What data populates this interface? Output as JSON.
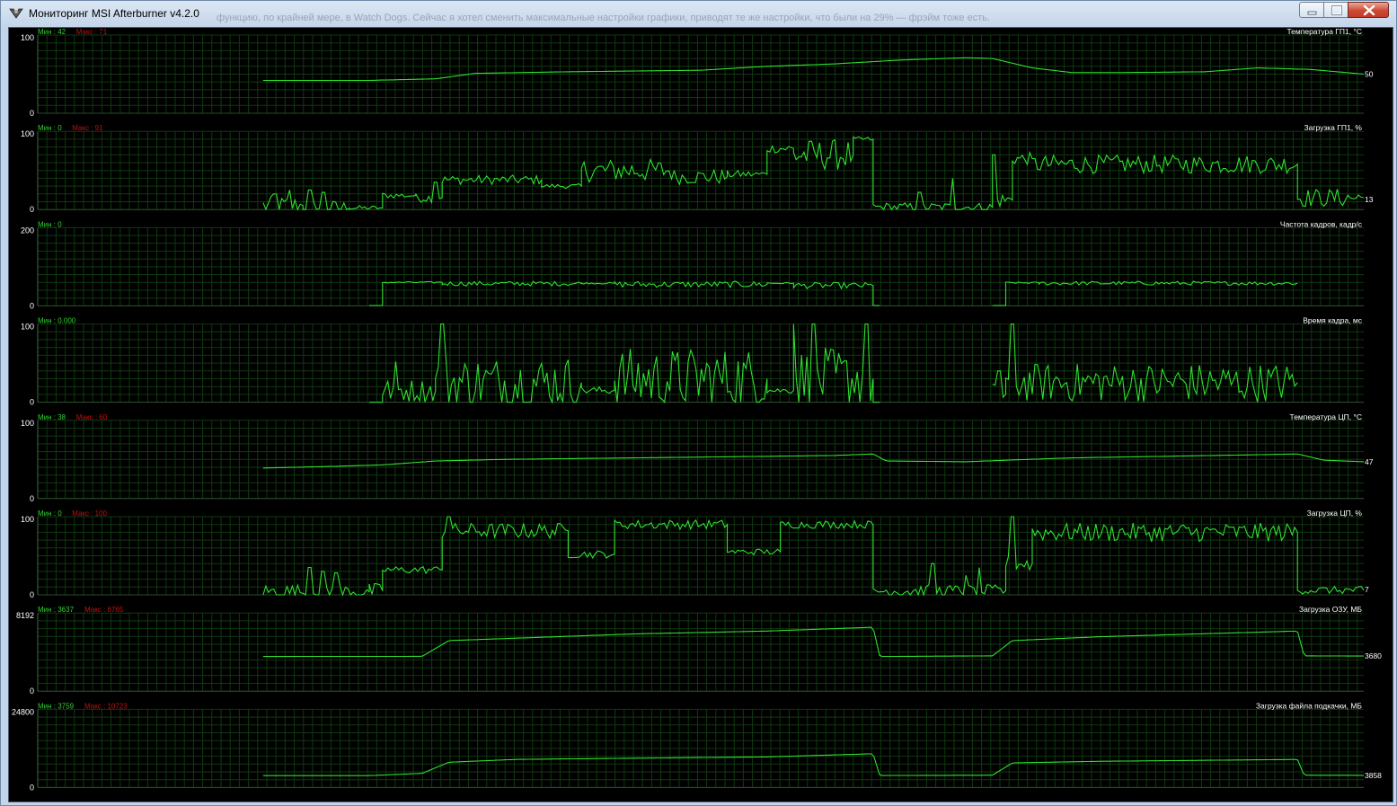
{
  "window": {
    "title": "Мониторинг MSI Afterburner v4.2.0",
    "background_text": "функцию, по крайней мере, в Watch Dogs. Сейчас я хотел сменить максимальные настройки графики, приводят те же настройки, что были на 29% — фрэйм тоже есть.",
    "controls": [
      "minimize-icon",
      "maximize-icon",
      "close-icon"
    ]
  },
  "colors": {
    "background": "#000000",
    "grid": "#0f3a0f",
    "line": "#2fe02f",
    "label": "#ffffff",
    "min_text": "#2fd12f",
    "max_text": "#c01010"
  },
  "chart_data": [
    {
      "type": "line",
      "title": "Температура ГП1, °C",
      "ylim": [
        0,
        100
      ],
      "ytick_top": "100",
      "ytick_bottom": "0",
      "min_label": "Мин : 42",
      "max_label": "Макс : 71",
      "current": "50",
      "x_start": 0.17,
      "anchors": [
        [
          0.17,
          42
        ],
        [
          0.25,
          42
        ],
        [
          0.3,
          44
        ],
        [
          0.33,
          51
        ],
        [
          0.4,
          53
        ],
        [
          0.5,
          55
        ],
        [
          0.55,
          60
        ],
        [
          0.6,
          63
        ],
        [
          0.65,
          68
        ],
        [
          0.7,
          71
        ],
        [
          0.72,
          70
        ],
        [
          0.75,
          58
        ],
        [
          0.78,
          52
        ],
        [
          0.82,
          52
        ],
        [
          0.88,
          53
        ],
        [
          0.92,
          58
        ],
        [
          0.96,
          56
        ],
        [
          1.0,
          50
        ]
      ]
    },
    {
      "type": "line",
      "title": "Загрузка ГП1, %",
      "ylim": [
        0,
        100
      ],
      "ytick_top": "100",
      "ytick_bottom": "0",
      "min_label": "Мин : 0",
      "max_label": "Макс : 91",
      "current": "13",
      "x_start": 0.17,
      "segments": [
        {
          "x": [
            0.17,
            0.2
          ],
          "level": 5,
          "noise": 12,
          "spikes": [
            [
              0.18,
              20
            ],
            [
              0.19,
              25
            ]
          ]
        },
        {
          "x": [
            0.2,
            0.235
          ],
          "level": 2,
          "noise": 10,
          "spikes": [
            [
              0.205,
              25
            ],
            [
              0.215,
              22
            ]
          ]
        },
        {
          "x": [
            0.235,
            0.26
          ],
          "level": 2,
          "noise": 3
        },
        {
          "x": [
            0.26,
            0.285
          ],
          "level": 18,
          "noise": 4
        },
        {
          "x": [
            0.285,
            0.305
          ],
          "level": 15,
          "noise": 6,
          "spikes": [
            [
              0.3,
              35
            ]
          ]
        },
        {
          "x": [
            0.305,
            0.38
          ],
          "level": 38,
          "noise": 6
        },
        {
          "x": [
            0.38,
            0.41
          ],
          "level": 30,
          "noise": 3
        },
        {
          "x": [
            0.41,
            0.48
          ],
          "level": 50,
          "noise": 15
        },
        {
          "x": [
            0.48,
            0.52
          ],
          "level": 42,
          "noise": 10
        },
        {
          "x": [
            0.52,
            0.55
          ],
          "level": 45,
          "noise": 5
        },
        {
          "x": [
            0.55,
            0.57
          ],
          "level": 78,
          "noise": 6
        },
        {
          "x": [
            0.57,
            0.615
          ],
          "level": 70,
          "noise": 20
        },
        {
          "x": [
            0.615,
            0.63
          ],
          "level": 90,
          "noise": 3
        },
        {
          "x": [
            0.63,
            0.72
          ],
          "level": 3,
          "noise": 6,
          "spikes": [
            [
              0.665,
              22
            ],
            [
              0.69,
              40
            ]
          ]
        },
        {
          "x": [
            0.72,
            0.735
          ],
          "level": 12,
          "noise": 10,
          "spikes": [
            [
              0.72,
              70
            ]
          ]
        },
        {
          "x": [
            0.735,
            0.75
          ],
          "level": 65,
          "noise": 8
        },
        {
          "x": [
            0.75,
            0.95
          ],
          "level": 58,
          "noise": 12
        },
        {
          "x": [
            0.95,
            1.0
          ],
          "level": 15,
          "noise": 12
        }
      ]
    },
    {
      "type": "line",
      "title": "Частота кадров, кадр/с",
      "ylim": [
        0,
        200
      ],
      "ytick_top": "200",
      "ytick_bottom": "0",
      "min_label": "Мин : 0",
      "max_label": "",
      "current": "",
      "x_start": 0.25,
      "segments": [
        {
          "x": [
            0.25,
            0.26
          ],
          "level": 1,
          "noise": 0
        },
        {
          "x": [
            0.26,
            0.305
          ],
          "level": 60,
          "noise": 2
        },
        {
          "x": [
            0.305,
            0.41
          ],
          "level": 57,
          "noise": 6
        },
        {
          "x": [
            0.41,
            0.435
          ],
          "level": 58,
          "noise": 2
        },
        {
          "x": [
            0.435,
            0.55
          ],
          "level": 55,
          "noise": 8
        },
        {
          "x": [
            0.55,
            0.57
          ],
          "level": 58,
          "noise": 2
        },
        {
          "x": [
            0.57,
            0.63
          ],
          "level": 52,
          "noise": 8
        },
        {
          "x": [
            0.63,
            0.635
          ],
          "level": 1,
          "noise": 0
        },
        {
          "x": [
            0.72,
            0.73
          ],
          "level": 1,
          "noise": 0
        },
        {
          "x": [
            0.73,
            0.755
          ],
          "level": 59,
          "noise": 2
        },
        {
          "x": [
            0.755,
            0.95
          ],
          "level": 58,
          "noise": 5
        }
      ]
    },
    {
      "type": "line",
      "title": "Время кадра, мс",
      "ylim": [
        0,
        100
      ],
      "ytick_top": "100",
      "ytick_bottom": "0",
      "min_label": "Мин : 0.000",
      "max_label": "",
      "current": "",
      "x_start": 0.25,
      "segments": [
        {
          "x": [
            0.25,
            0.26
          ],
          "level": 0,
          "noise": 0
        },
        {
          "x": [
            0.26,
            0.3
          ],
          "level": 15,
          "noise": 15,
          "spikes": [
            [
              0.27,
              52
            ]
          ]
        },
        {
          "x": [
            0.3,
            0.41
          ],
          "level": 25,
          "noise": 35,
          "spikes": [
            [
              0.305,
              100
            ]
          ]
        },
        {
          "x": [
            0.41,
            0.435
          ],
          "level": 15,
          "noise": 5
        },
        {
          "x": [
            0.435,
            0.55
          ],
          "level": 30,
          "noise": 40
        },
        {
          "x": [
            0.55,
            0.57
          ],
          "level": 15,
          "noise": 4
        },
        {
          "x": [
            0.57,
            0.63
          ],
          "level": 30,
          "noise": 40,
          "spikes": [
            [
              0.57,
              100
            ],
            [
              0.585,
              100
            ],
            [
              0.625,
              100
            ]
          ]
        },
        {
          "x": [
            0.63,
            0.635
          ],
          "level": 0,
          "noise": 0
        },
        {
          "x": [
            0.72,
            0.73
          ],
          "level": 10,
          "noise": 15,
          "spikes": [
            [
              0.725,
              40
            ]
          ]
        },
        {
          "x": [
            0.73,
            0.95
          ],
          "level": 25,
          "noise": 25,
          "spikes": [
            [
              0.735,
              100
            ]
          ]
        }
      ]
    },
    {
      "type": "line",
      "title": "Температура ЦП, °C",
      "ylim": [
        0,
        100
      ],
      "ytick_top": "100",
      "ytick_bottom": "0",
      "min_label": "Мин : 38",
      "max_label": "Макс : 60",
      "current": "47",
      "x_start": 0.17,
      "anchors": [
        [
          0.17,
          39
        ],
        [
          0.22,
          41
        ],
        [
          0.26,
          43
        ],
        [
          0.3,
          48
        ],
        [
          0.35,
          50
        ],
        [
          0.45,
          52
        ],
        [
          0.55,
          54
        ],
        [
          0.6,
          55
        ],
        [
          0.63,
          57
        ],
        [
          0.64,
          48
        ],
        [
          0.7,
          47
        ],
        [
          0.73,
          49
        ],
        [
          0.78,
          52
        ],
        [
          0.85,
          54
        ],
        [
          0.92,
          56
        ],
        [
          0.95,
          57
        ],
        [
          0.97,
          49
        ],
        [
          1.0,
          47
        ]
      ]
    },
    {
      "type": "line",
      "title": "Загрузка ЦП, %",
      "ylim": [
        0,
        100
      ],
      "ytick_top": "100",
      "ytick_bottom": "0",
      "min_label": "Мин : 0",
      "max_label": "Макс : 100",
      "current": "7",
      "x_start": 0.17,
      "segments": [
        {
          "x": [
            0.17,
            0.25
          ],
          "level": 4,
          "noise": 10,
          "spikes": [
            [
              0.205,
              35
            ],
            [
              0.215,
              30
            ],
            [
              0.225,
              28
            ]
          ]
        },
        {
          "x": [
            0.25,
            0.26
          ],
          "level": 5,
          "noise": 10
        },
        {
          "x": [
            0.26,
            0.305
          ],
          "level": 32,
          "noise": 5
        },
        {
          "x": [
            0.305,
            0.4
          ],
          "level": 82,
          "noise": 10,
          "spikes": [
            [
              0.31,
              100
            ]
          ]
        },
        {
          "x": [
            0.4,
            0.435
          ],
          "level": 52,
          "noise": 5
        },
        {
          "x": [
            0.435,
            0.52
          ],
          "level": 90,
          "noise": 6
        },
        {
          "x": [
            0.52,
            0.56
          ],
          "level": 55,
          "noise": 4
        },
        {
          "x": [
            0.56,
            0.63
          ],
          "level": 90,
          "noise": 5
        },
        {
          "x": [
            0.63,
            0.73
          ],
          "level": 5,
          "noise": 8,
          "spikes": [
            [
              0.675,
              40
            ],
            [
              0.7,
              25
            ],
            [
              0.71,
              35
            ]
          ]
        },
        {
          "x": [
            0.73,
            0.75
          ],
          "level": 40,
          "noise": 10,
          "spikes": [
            [
              0.735,
              100
            ]
          ]
        },
        {
          "x": [
            0.75,
            0.95
          ],
          "level": 80,
          "noise": 12
        },
        {
          "x": [
            0.95,
            1.0
          ],
          "level": 6,
          "noise": 5
        }
      ]
    },
    {
      "type": "line",
      "title": "Загрузка ОЗУ, МБ",
      "ylim": [
        0,
        8192
      ],
      "ytick_top": "8192",
      "ytick_bottom": "0",
      "min_label": "Мин : 3637",
      "max_label": "Макс : 6765",
      "current": "3680",
      "x_start": 0.17,
      "anchors": [
        [
          0.17,
          3637
        ],
        [
          0.29,
          3650
        ],
        [
          0.31,
          5300
        ],
        [
          0.36,
          5550
        ],
        [
          0.45,
          6000
        ],
        [
          0.55,
          6300
        ],
        [
          0.63,
          6700
        ],
        [
          0.635,
          3637
        ],
        [
          0.72,
          3700
        ],
        [
          0.735,
          5300
        ],
        [
          0.8,
          5700
        ],
        [
          0.9,
          6100
        ],
        [
          0.95,
          6300
        ],
        [
          0.955,
          3700
        ],
        [
          1.0,
          3680
        ]
      ]
    },
    {
      "type": "line",
      "title": "Загрузка файла подкачки, МБ",
      "ylim": [
        0,
        24800
      ],
      "ytick_top": "24800",
      "ytick_bottom": "0",
      "min_label": "Мин : 3759",
      "max_label": "Макс : 10723",
      "current": "3858",
      "x_start": 0.17,
      "anchors": [
        [
          0.17,
          3759
        ],
        [
          0.25,
          3760
        ],
        [
          0.29,
          4500
        ],
        [
          0.31,
          8000
        ],
        [
          0.36,
          8900
        ],
        [
          0.45,
          9300
        ],
        [
          0.55,
          9700
        ],
        [
          0.63,
          10700
        ],
        [
          0.635,
          3800
        ],
        [
          0.72,
          3900
        ],
        [
          0.735,
          7800
        ],
        [
          0.8,
          8300
        ],
        [
          0.9,
          8700
        ],
        [
          0.95,
          8900
        ],
        [
          0.955,
          3900
        ],
        [
          1.0,
          3858
        ]
      ]
    }
  ]
}
